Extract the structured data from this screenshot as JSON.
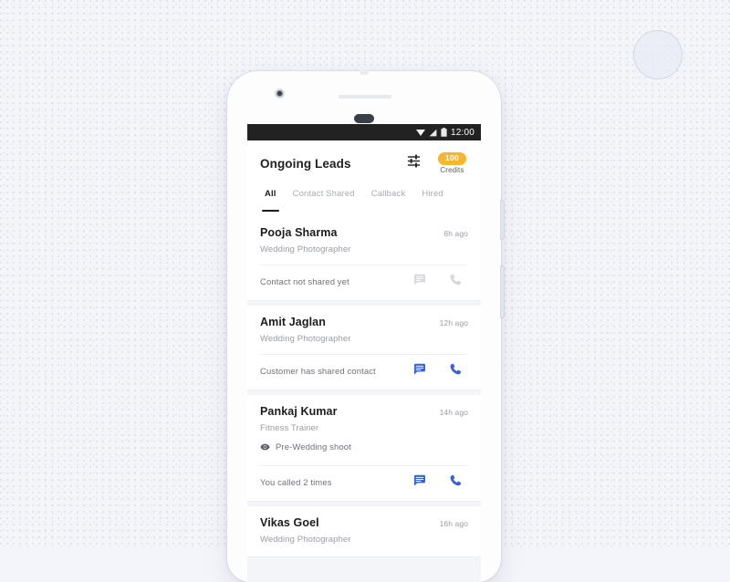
{
  "device": {
    "frame_name": "android-phone-mockup",
    "camera_icon": "front-camera-icon",
    "earpiece_icon": "earpiece-speaker",
    "sensor_icon": "proximity-sensor"
  },
  "status_bar": {
    "time": "12:00",
    "icons": [
      "wifi-icon",
      "signal-icon",
      "battery-icon"
    ]
  },
  "app_bar": {
    "title": "Ongoing Leads",
    "filter_icon": "tune-filter-icon",
    "credits_count": "100",
    "credits_label": "Credits",
    "credits_color": "#f5b731"
  },
  "tabs": [
    {
      "label": "All",
      "active": true
    },
    {
      "label": "Contact Shared",
      "active": false
    },
    {
      "label": "Callback",
      "active": false
    },
    {
      "label": "Hired",
      "active": false
    }
  ],
  "colors": {
    "accent_blue": "#3f5fd4",
    "muted_icon": "#d6d8e0",
    "badge_amber": "#f5b731",
    "active_tab": "#1b1b1b",
    "page_bg": "#f4f5f9"
  },
  "leads": [
    {
      "name": "Pooja Sharma",
      "time": "8h ago",
      "role": "Wedding Photographer",
      "tag": null,
      "tag_icon": null,
      "status": "Contact not shared yet",
      "actions_enabled": false,
      "chat_icon": "chat-bubble-icon",
      "call_icon": "phone-call-icon"
    },
    {
      "name": "Amit Jaglan",
      "time": "12h ago",
      "role": "Wedding Photographer",
      "tag": null,
      "tag_icon": null,
      "status": "Customer has shared contact",
      "actions_enabled": true,
      "chat_icon": "chat-bubble-icon",
      "call_icon": "phone-call-icon"
    },
    {
      "name": "Pankaj Kumar",
      "time": "14h ago",
      "role": "Fitness Trainer",
      "tag": "Pre-Wedding shoot",
      "tag_icon": "eye-icon",
      "status": "You called 2 times",
      "actions_enabled": true,
      "chat_icon": "chat-bubble-icon",
      "call_icon": "phone-call-icon"
    },
    {
      "name": "Vikas Goel",
      "time": "16h ago",
      "role": "Wedding Photographer",
      "tag": null,
      "tag_icon": null,
      "status": null,
      "actions_enabled": false,
      "chat_icon": "chat-bubble-icon",
      "call_icon": "phone-call-icon"
    }
  ]
}
